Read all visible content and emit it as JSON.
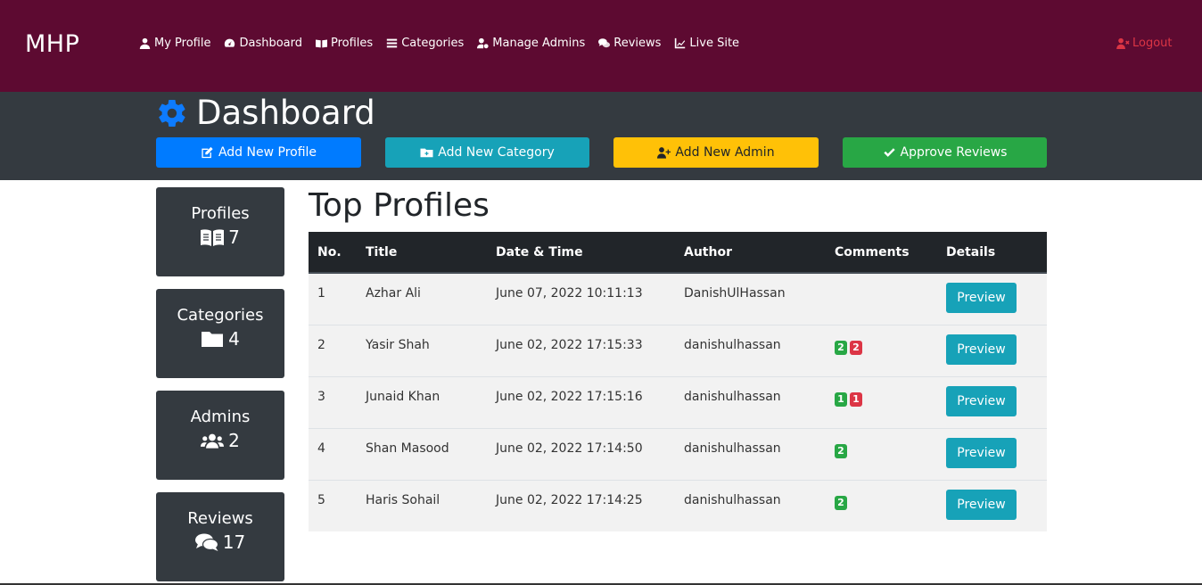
{
  "brand": "MHP",
  "nav": {
    "my_profile": "My Profile",
    "dashboard": "Dashboard",
    "profiles": "Profiles",
    "categories": "Categories",
    "manage_admins": "Manage Admins",
    "reviews": "Reviews",
    "live_site": "Live Site",
    "logout": "Logout"
  },
  "header": {
    "title": "Dashboard",
    "buttons": {
      "add_profile": "Add New Profile",
      "add_category": "Add New Category",
      "add_admin": "Add New Admin",
      "approve_reviews": "Approve Reviews"
    }
  },
  "cards": [
    {
      "label": "Profiles",
      "value": "7",
      "icon": "book-icon"
    },
    {
      "label": "Categories",
      "value": "4",
      "icon": "folder-icon"
    },
    {
      "label": "Admins",
      "value": "2",
      "icon": "users-icon"
    },
    {
      "label": "Reviews",
      "value": "17",
      "icon": "comments-icon"
    }
  ],
  "section_title": "Top Profiles",
  "table": {
    "headers": [
      "No.",
      "Title",
      "Date & Time",
      "Author",
      "Comments",
      "Details"
    ],
    "rows": [
      {
        "no": "1",
        "title": "Azhar Ali",
        "datetime": "June 07, 2022 10:11:13",
        "author": "DanishUlHassan",
        "approved": "",
        "pending": "",
        "action": "Preview"
      },
      {
        "no": "2",
        "title": "Yasir Shah",
        "datetime": "June 02, 2022 17:15:33",
        "author": "danishulhassan",
        "approved": "2",
        "pending": "2",
        "action": "Preview"
      },
      {
        "no": "3",
        "title": "Junaid Khan",
        "datetime": "June 02, 2022 17:15:16",
        "author": "danishulhassan",
        "approved": "1",
        "pending": "1",
        "action": "Preview"
      },
      {
        "no": "4",
        "title": "Shan Masood",
        "datetime": "June 02, 2022 17:14:50",
        "author": "danishulhassan",
        "approved": "2",
        "pending": "",
        "action": "Preview"
      },
      {
        "no": "5",
        "title": "Haris Sohail",
        "datetime": "June 02, 2022 17:14:25",
        "author": "danishulhassan",
        "approved": "2",
        "pending": "",
        "action": "Preview"
      }
    ]
  },
  "colors": {
    "navbar": "#5d0a31",
    "header": "#343a40",
    "primary": "#007bff",
    "info": "#17a2b8",
    "warning": "#ffc107",
    "success": "#28a745",
    "danger": "#dc3545"
  }
}
